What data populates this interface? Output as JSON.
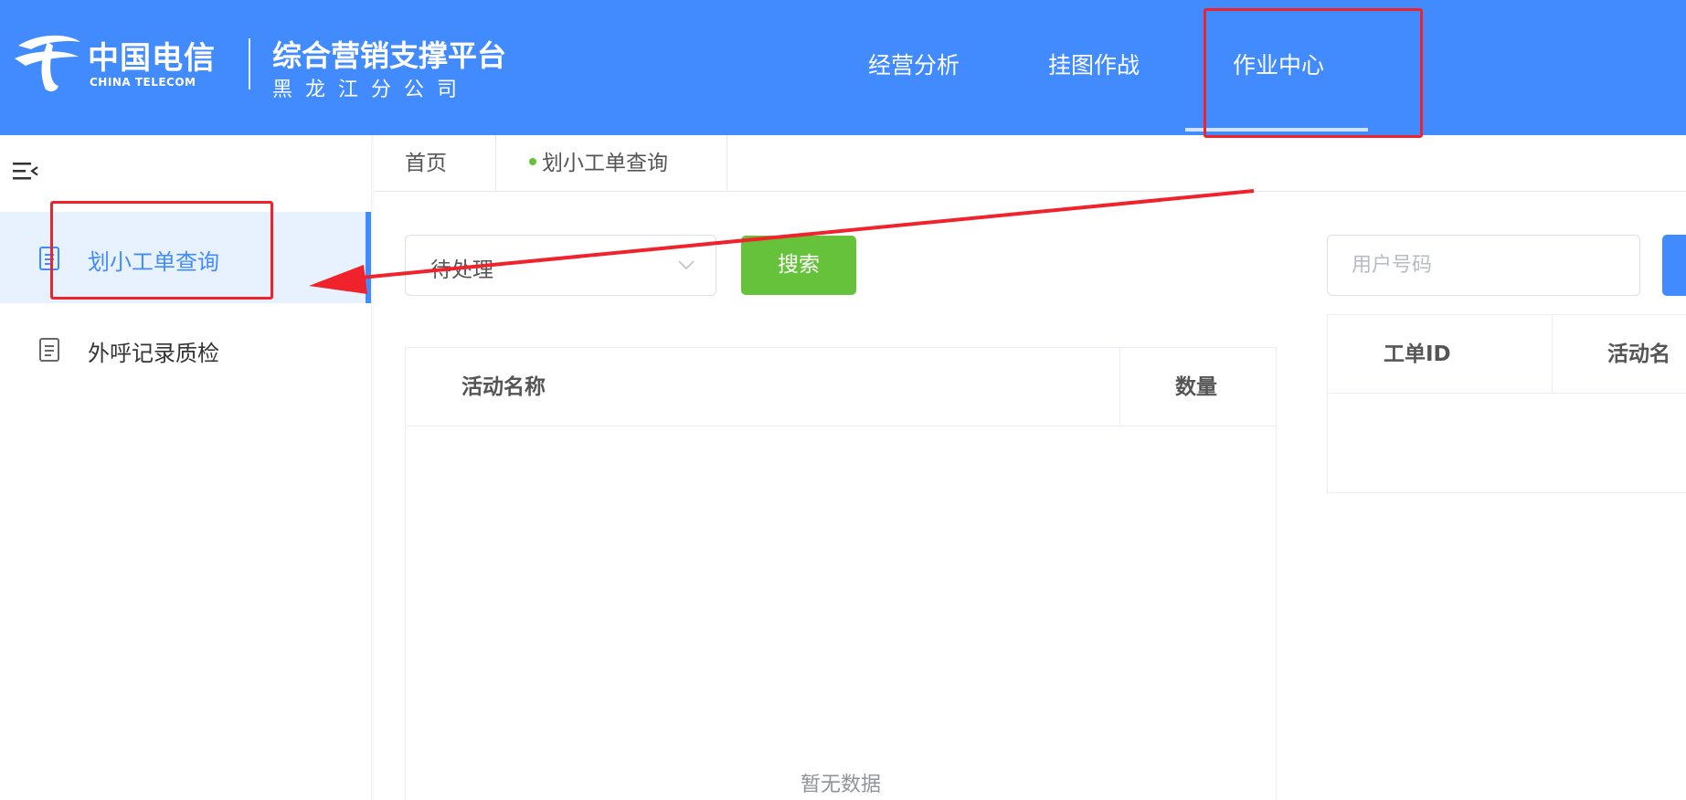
{
  "header": {
    "logo_cn": "中国电信",
    "logo_en": "CHINA TELECOM",
    "platform_title": "综合营销支撑平台",
    "platform_subtitle": "黑龙江分公司",
    "nav": [
      {
        "label": "经营分析",
        "active": false
      },
      {
        "label": "挂图作战",
        "active": false
      },
      {
        "label": "作业中心",
        "active": true
      }
    ],
    "accent_color": "#428bff"
  },
  "sidebar": {
    "toggle_icon": "menu-fold-icon",
    "items": [
      {
        "label": "划小工单查询",
        "icon": "document-icon",
        "active": true
      },
      {
        "label": "外呼记录质检",
        "icon": "document-icon",
        "active": false
      }
    ]
  },
  "breadcrumb": {
    "tabs": [
      {
        "label": "首页"
      },
      {
        "label": "划小工单查询",
        "active_dot_color": "#66c23a"
      }
    ]
  },
  "left_panel": {
    "status_select": {
      "value": "待处理",
      "icon": "chevron-down-icon"
    },
    "search_button_label": "搜索",
    "search_button_color": "#66c23a",
    "table": {
      "columns": [
        "活动名称",
        "数量"
      ],
      "rows": [],
      "empty_text": "暂无数据"
    }
  },
  "right_panel": {
    "user_number_placeholder": "用户号码",
    "table": {
      "columns": [
        "工单ID",
        "活动名"
      ],
      "rows": []
    }
  },
  "annotation": {
    "color": "#f0232d"
  }
}
